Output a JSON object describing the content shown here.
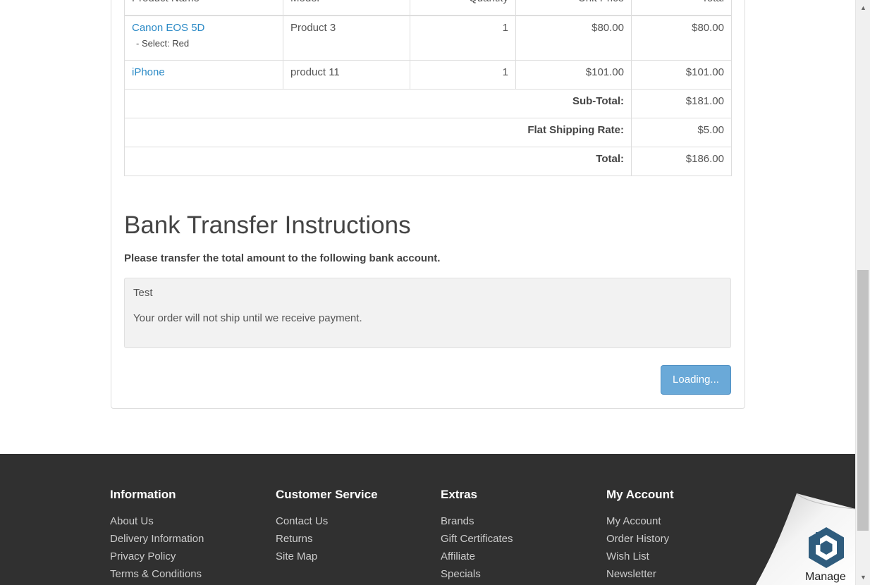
{
  "order_table": {
    "headers": [
      "Product Name",
      "Model",
      "Quantity",
      "Unit Price",
      "Total"
    ],
    "items": [
      {
        "name": "Canon EOS 5D",
        "option": "- Select: Red",
        "model": "Product 3",
        "quantity": "1",
        "unit_price": "$80.00",
        "total": "$80.00"
      },
      {
        "name": "iPhone",
        "option": "",
        "model": "product 11",
        "quantity": "1",
        "unit_price": "$101.00",
        "total": "$101.00"
      }
    ],
    "totals": [
      {
        "label": "Sub-Total:",
        "value": "$181.00"
      },
      {
        "label": "Flat Shipping Rate:",
        "value": "$5.00"
      },
      {
        "label": "Total:",
        "value": "$186.00"
      }
    ]
  },
  "bank": {
    "title": "Bank Transfer Instructions",
    "intro": "Please transfer the total amount to the following bank account.",
    "instructions": "Test",
    "notice": "Your order will not ship until we receive payment."
  },
  "confirm_button": {
    "label": "Loading..."
  },
  "footer": {
    "columns": [
      {
        "heading": "Information",
        "links": [
          "About Us",
          "Delivery Information",
          "Privacy Policy",
          "Terms & Conditions"
        ]
      },
      {
        "heading": "Customer Service",
        "links": [
          "Contact Us",
          "Returns",
          "Site Map"
        ]
      },
      {
        "heading": "Extras",
        "links": [
          "Brands",
          "Gift Certificates",
          "Affiliate",
          "Specials"
        ]
      },
      {
        "heading": "My Account",
        "links": [
          "My Account",
          "Order History",
          "Wish List",
          "Newsletter"
        ]
      }
    ]
  },
  "manage_widget": {
    "label": "Manage",
    "icon": "hexagon-b-logo-icon"
  },
  "colors": {
    "link": "#2b8ac6",
    "button": "#6aa9d8",
    "footer_bg": "#303030"
  }
}
